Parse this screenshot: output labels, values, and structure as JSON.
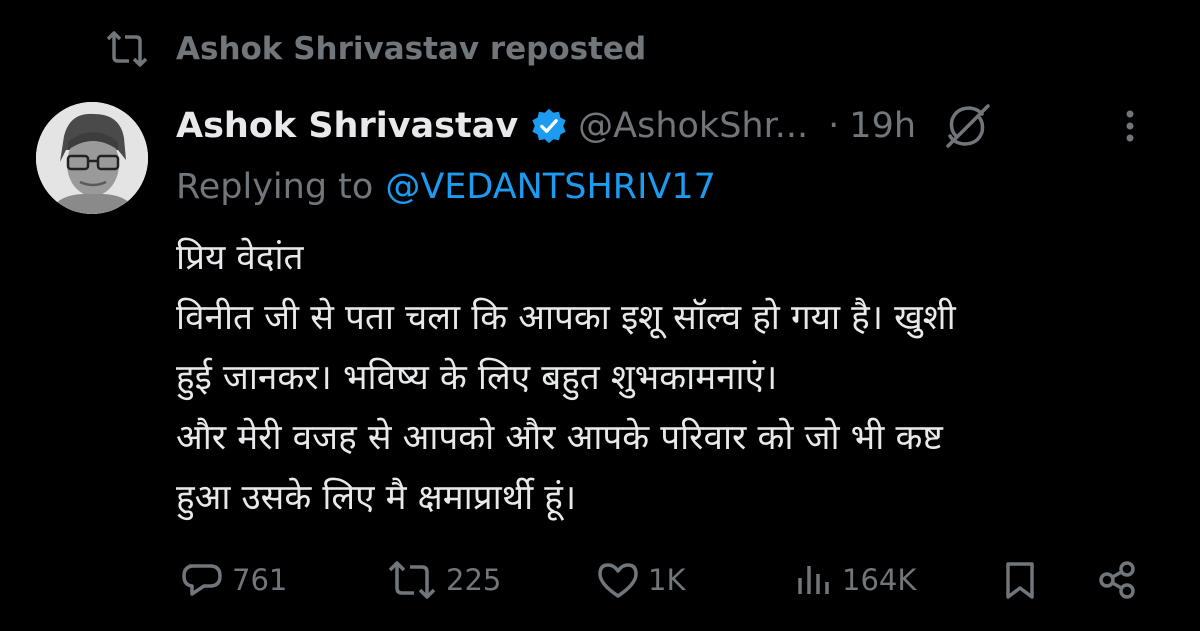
{
  "repost": {
    "icon": "repost-icon",
    "text": "Ashok Shrivastav reposted"
  },
  "author": {
    "name": "Ashok Shrivastav",
    "verified_icon": "verified-badge-icon",
    "handle": "@AshokShr...",
    "separator": "·",
    "time": "19h",
    "avatar_icon": "profile-photo"
  },
  "reply": {
    "prefix": "Replying to",
    "mention": "@VEDANTSHRIV17"
  },
  "body": {
    "lines": [
      "प्रिय वेदांत",
      "विनीत जी से पता चला कि आपका इशू सॉल्व हो गया है। खुशी",
      "हुई जानकर। भविष्य के लिए बहुत शुभकामनाएं।",
      "और मेरी वजह से आपको और आपके परिवार को जो भी कष्ट",
      "हुआ उसके लिए मै क्षमाप्रार्थी हूं।"
    ]
  },
  "actions": {
    "replies": "761",
    "reposts": "225",
    "likes": "1K",
    "views": "164K"
  },
  "colors": {
    "background": "#000000",
    "text": "#e7e9ea",
    "muted": "#71767b",
    "accent": "#1d9bf0"
  }
}
